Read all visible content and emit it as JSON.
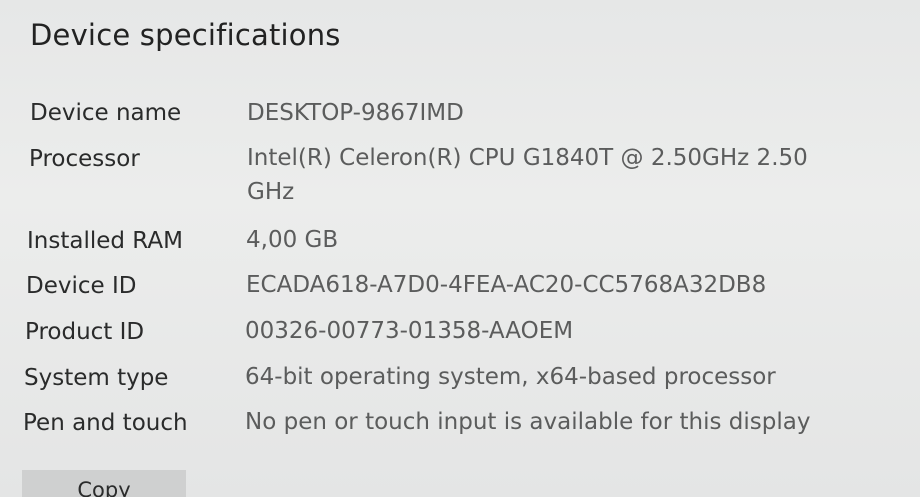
{
  "section": {
    "title": "Device specifications"
  },
  "specs": [
    {
      "label": "Device name",
      "value": "DESKTOP-9867IMD"
    },
    {
      "label": "Processor",
      "value": "Intel(R) Celeron(R) CPU G1840T @ 2.50GHz   2.50 GHz"
    },
    {
      "label": "Installed RAM",
      "value": "4,00 GB"
    },
    {
      "label": "Device ID",
      "value": "ECADA618-A7D0-4FEA-AC20-CC5768A32DB8"
    },
    {
      "label": "Product ID",
      "value": "00326-00773-01358-AAOEM"
    },
    {
      "label": "System type",
      "value": "64-bit operating system, x64-based processor"
    },
    {
      "label": "Pen and touch",
      "value": "No pen or touch input is available for this display"
    }
  ],
  "actions": {
    "copy_label": "Copy"
  }
}
